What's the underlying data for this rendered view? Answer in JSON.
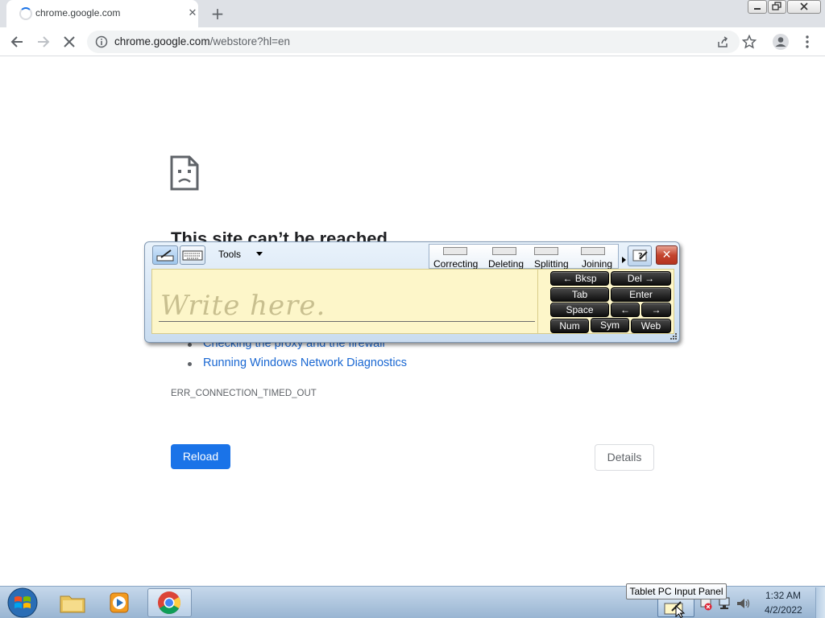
{
  "browser": {
    "tab_title": "chrome.google.com",
    "tab_close": "✕",
    "new_tab": "+",
    "url_host": "chrome.google.com",
    "url_path": "/webstore?hl=en"
  },
  "page": {
    "title": "This site can’t be reached",
    "suggestions": [
      "Checking the proxy and the firewall",
      "Running Windows Network Diagnostics"
    ],
    "error_code": "ERR_CONNECTION_TIMED_OUT",
    "reload_label": "Reload",
    "details_label": "Details"
  },
  "input_panel": {
    "tools_label": "Tools",
    "gestures": [
      "Correcting",
      "Deleting",
      "Splitting",
      "Joining"
    ],
    "write_hint": "Write here.",
    "close": "✕",
    "keys": {
      "bksp": "← Bksp",
      "del": "Del →",
      "tab": "Tab",
      "enter": "Enter",
      "space": "Space",
      "left": "←",
      "right": "→",
      "num": "Num",
      "sym": "Sym",
      "web": "Web"
    }
  },
  "taskbar": {
    "tooltip": "Tablet PC Input Panel",
    "time": "1:32 AM",
    "date": "4/2/2022"
  },
  "colors": {
    "accent": "#1a73e8",
    "link": "#1967d2",
    "write_area": "#fdf6c9",
    "taskbar": "#b0c8e0"
  }
}
